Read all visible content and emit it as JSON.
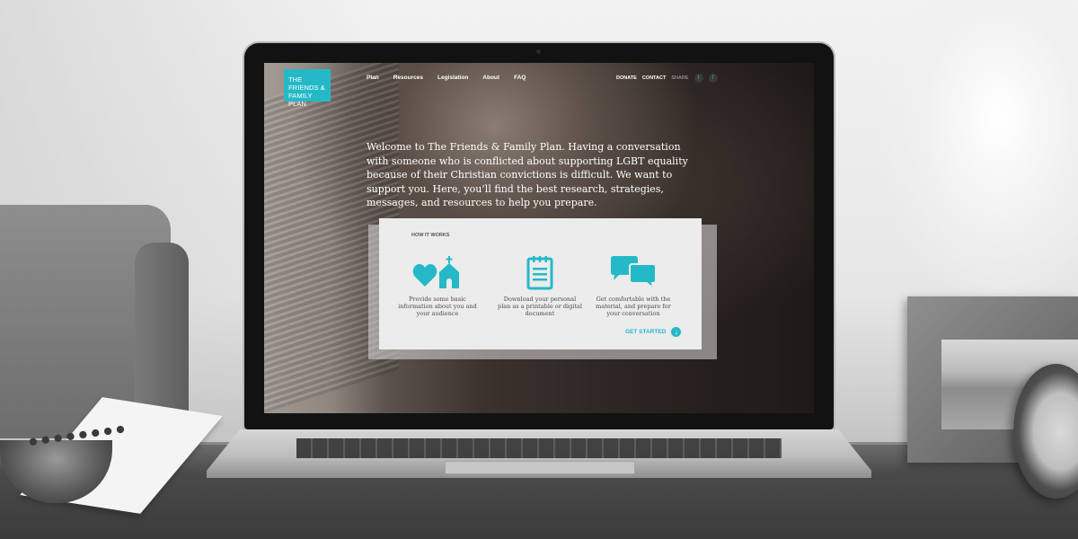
{
  "site": {
    "logo_text": "The Friends & Family Plan",
    "nav": [
      "Plan",
      "Resources",
      "Legislation",
      "About",
      "FAQ"
    ],
    "top_right": {
      "donate": "DONATE",
      "contact": "CONTACT",
      "share": "SHARE"
    },
    "social": [
      {
        "name": "twitter-icon",
        "glyph": "t"
      },
      {
        "name": "facebook-icon",
        "glyph": "f"
      }
    ],
    "intro": "Welcome to The Friends & Family Plan. Having a conversation with someone who is conflicted about supporting LGBT equality because of their Christian convictions is difficult. We want to support you. Here, you’ll find the best research, strategies, messages, and resources to help you prepare.",
    "how_it_works": {
      "title": "HOW IT WORKS",
      "steps": [
        {
          "icon": "heart-church-icon",
          "text": "Provide some basic information about you and your audience"
        },
        {
          "icon": "notepad-icon",
          "text": "Download your personal plan as a printable or digital document"
        },
        {
          "icon": "speech-bubbles-icon",
          "text": "Get comfortable with the material, and prepare for your conversation"
        }
      ],
      "cta": "GET STARTED"
    }
  },
  "colors": {
    "accent": "#25b9c8",
    "panel": "#ececec"
  }
}
